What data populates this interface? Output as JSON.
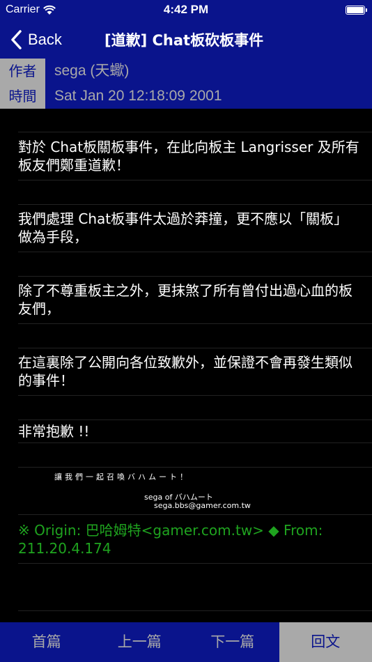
{
  "status_bar": {
    "carrier": "Carrier",
    "time": "4:42 PM"
  },
  "nav": {
    "back_label": "Back",
    "title": "[道歉] Chat板砍板事件"
  },
  "header": {
    "author_label": "作者",
    "author_value": "sega (天蠍)",
    "time_label": "時間",
    "time_value": "Sat Jan 20 12:18:09 2001"
  },
  "article": {
    "paragraphs": [
      "對於 Chat板關板事件，在此向板主 Langrisser 及所有板友們鄭重道歉！",
      "我們處理 Chat板事件太過於莽撞，更不應以「關板」做為手段，",
      "除了不尊重板主之外，更抹煞了所有曾付出過心血的板友們，",
      "在這裏除了公開向各位致歉外，並保證不會再發生類似的事件！",
      "非常抱歉 !!"
    ],
    "signature": {
      "line1": "讓我們一起召喚バハムート！",
      "line2": "sega of バハムート",
      "line3": "sega.bbs@gamer.com.tw"
    },
    "origin": "※ Origin: 巴哈姆特<gamer.com.tw> ◆ From: 211.20.4.174"
  },
  "tabs": [
    {
      "label": "首篇",
      "active": false
    },
    {
      "label": "上一篇",
      "active": false
    },
    {
      "label": "下一篇",
      "active": false
    },
    {
      "label": "回文",
      "active": true
    }
  ],
  "colors": {
    "bar_blue": "#0a148c",
    "label_gray": "#a9a9a9",
    "origin_green": "#1fa31f",
    "background": "#000000"
  },
  "icons": {
    "wifi": "wifi-icon",
    "battery": "battery-icon",
    "back": "chevron-left-icon"
  }
}
